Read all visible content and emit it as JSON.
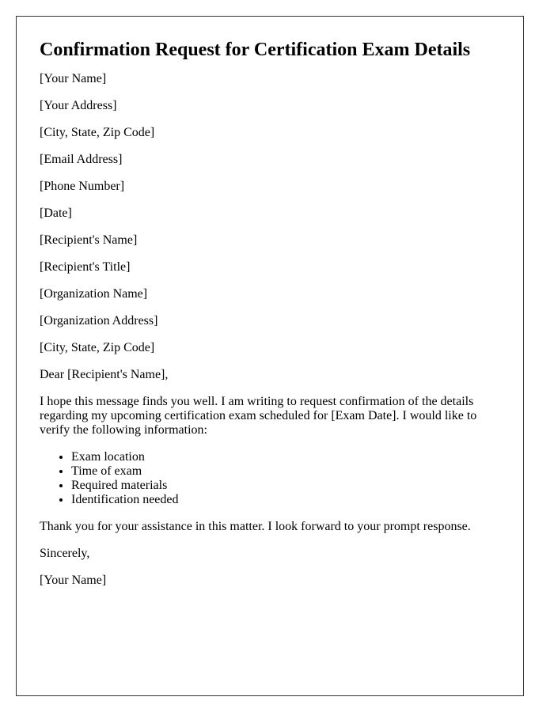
{
  "title": "Confirmation Request for Certification Exam Details",
  "sender": {
    "name": "[Your Name]",
    "address": "[Your Address]",
    "city_state_zip": "[City, State, Zip Code]",
    "email": "[Email Address]",
    "phone": "[Phone Number]",
    "date": "[Date]"
  },
  "recipient": {
    "name": "[Recipient's Name]",
    "title": "[Recipient's Title]",
    "organization": "[Organization Name]",
    "organization_address": "[Organization Address]",
    "city_state_zip": "[City, State, Zip Code]"
  },
  "salutation": "Dear [Recipient's Name],",
  "body": {
    "intro": "I hope this message finds you well. I am writing to request confirmation of the details regarding my upcoming certification exam scheduled for [Exam Date]. I would like to verify the following information:",
    "items": [
      "Exam location",
      "Time of exam",
      "Required materials",
      "Identification needed"
    ],
    "closing_paragraph": "Thank you for your assistance in this matter. I look forward to your prompt response."
  },
  "closing": "Sincerely,",
  "signature": "[Your Name]"
}
